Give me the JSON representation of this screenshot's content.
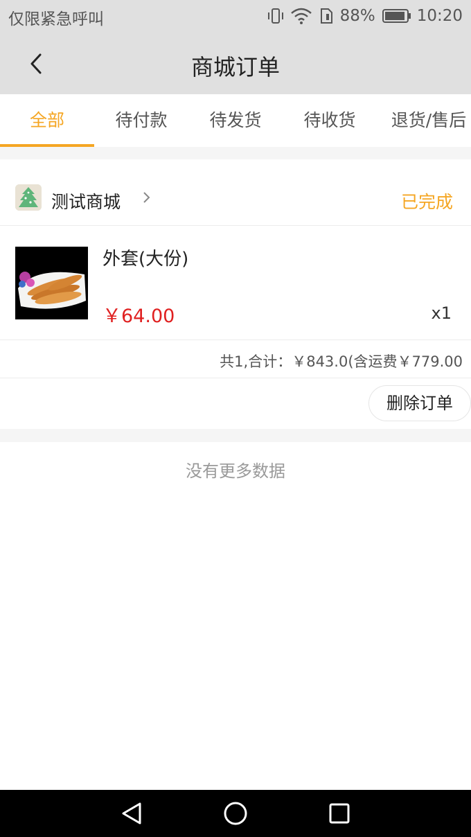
{
  "status_bar": {
    "left_text": "仅限紧急呼叫",
    "battery": "88%",
    "time": "10:20"
  },
  "nav": {
    "title": "商城订单"
  },
  "tabs": [
    {
      "label": "全部",
      "active": true
    },
    {
      "label": "待付款",
      "active": false
    },
    {
      "label": "待发货",
      "active": false
    },
    {
      "label": "待收货",
      "active": false
    },
    {
      "label": "退货/售后",
      "active": false
    }
  ],
  "order": {
    "shop_name": "测试商城",
    "status": "已完成",
    "product": {
      "name": "外套(大份)",
      "price": "￥64.00",
      "qty": "x1"
    },
    "summary": "共1,合计：￥843.0(含运费￥779.00",
    "delete_label": "删除订单"
  },
  "footer": {
    "no_more": "没有更多数据"
  },
  "colors": {
    "accent": "#f5a623",
    "price": "#e02020",
    "header_bg": "#e0e0e0"
  }
}
